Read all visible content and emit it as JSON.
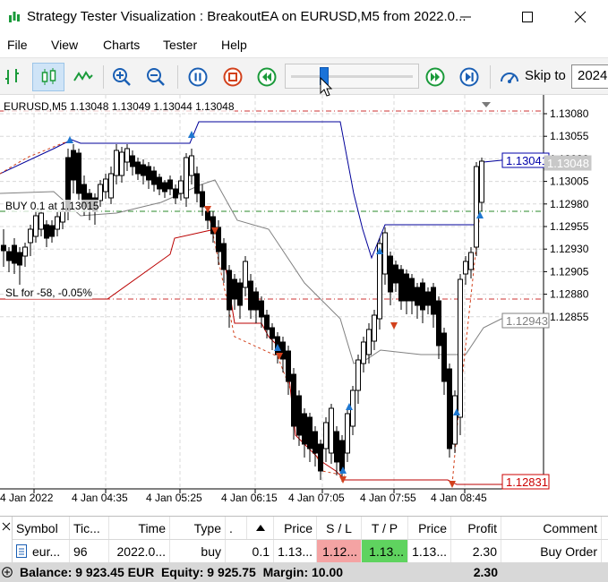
{
  "window": {
    "title": "Strategy Tester Visualization : BreakoutEA on EURUSD,M5 from 2022.0..."
  },
  "menu": [
    "File",
    "View",
    "Charts",
    "Tester",
    "Help"
  ],
  "toolbar": {
    "skip_label": "Skip to",
    "skip_value": "2024",
    "slider_progress": 0.25
  },
  "chart": {
    "symbol_info": "EURUSD,M5 1.13048 1.13049 1.13044 1.13048",
    "buy_label": "BUY 0.1 at 1.13015",
    "sl_label": "SL for -58, -0.05%",
    "price_ticks": [
      "1.13080",
      "1.13055",
      "1.13030",
      "1.13005",
      "1.12980",
      "1.12955",
      "1.12930",
      "1.12905",
      "1.12880",
      "1.12855"
    ],
    "time_ticks": [
      "4 Jan 2022",
      "4 Jan 04:35",
      "4 Jan 05:25",
      "4 Jan 06:15",
      "4 Jan 07:05",
      "4 Jan 07:55",
      "4 Jan 08:45"
    ],
    "price_badges": [
      {
        "text": "1.13041",
        "color": "#0000aa"
      },
      {
        "text": "1.13048",
        "color": "#9a9a9a"
      },
      {
        "text": "1.12943",
        "color": "#808080"
      },
      {
        "text": "1.12831",
        "color": "#cc0000"
      }
    ],
    "colors": {
      "up_channel": "#000099",
      "down_channel": "#bb0000",
      "middle_line": "#808080",
      "buy_arrow": "#1f77d0",
      "sell_arrow": "#d2411c",
      "candles": "#000000"
    }
  },
  "table": {
    "headers": [
      "Symbol",
      "Tic...",
      "Time",
      "Type",
      ".",
      "",
      "Price",
      "S / L",
      "T / P",
      "Price",
      "Profit",
      "Comment"
    ],
    "row": {
      "symbol": "eur...",
      "ticket": "96",
      "time": "2022.0...",
      "type": "buy",
      "volume": "0.1",
      "price_open": "1.13...",
      "sl": "1.12...",
      "tp": "1.13...",
      "price_current": "1.13...",
      "profit": "2.30",
      "comment": "Buy Order"
    },
    "balance_line": "Balance: 9 923.45 EUR  Equity: 9 925.75  Margin: 10.00",
    "balance_profit": "2.30"
  }
}
